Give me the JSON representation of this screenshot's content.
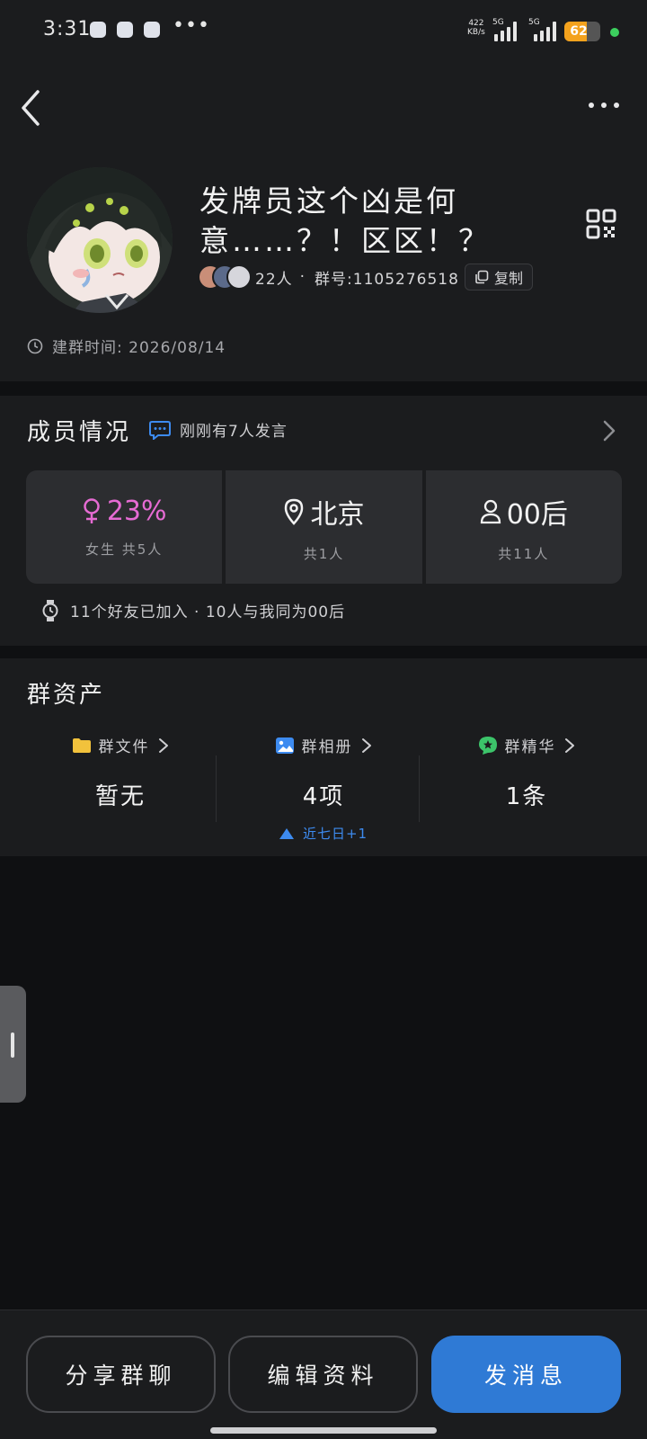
{
  "status_bar": {
    "time": "3:31",
    "more": "•••",
    "net_speed_value": "422",
    "net_speed_unit": "KB/s",
    "net_label_1": "5G",
    "net_label_2": "5G",
    "battery": "62",
    "battery_level": 0.62,
    "battery_color": "#f4a21d"
  },
  "header": {
    "group_name": "发牌员这个凶是何意……？！区区！？",
    "member_count": "22人",
    "separator": "·",
    "group_id": "群号:1105276518",
    "copy_label": "复制",
    "created": "建群时间: 2026/08/14"
  },
  "members": {
    "title": "成员情况",
    "activity": "刚刚有7人发言",
    "stats": [
      {
        "value": "23%",
        "sub": "女生 共5人",
        "icon": "female-icon",
        "color": "#e66bd3"
      },
      {
        "value": "北京",
        "sub": "共1人",
        "icon": "location-icon"
      },
      {
        "value": "00后",
        "sub": "共11人",
        "icon": "person-icon"
      }
    ],
    "friends_line": "11个好友已加入 · 10人与我同为00后"
  },
  "assets": {
    "title": "群资产",
    "items": [
      {
        "label": "群文件",
        "value": "暂无",
        "icon": "folder-icon",
        "color": "#f2c23c"
      },
      {
        "label": "群相册",
        "value": "4项",
        "icon": "image-icon",
        "color": "#3d8bf0",
        "trend": "近七日+1"
      },
      {
        "label": "群精华",
        "value": "1条",
        "icon": "star-badge-icon",
        "color": "#3cc46a"
      }
    ]
  },
  "bottom": {
    "share": "分享群聊",
    "edit": "编辑资料",
    "send": "发消息"
  },
  "colors": {
    "accent": "#2f7ad5",
    "background": "#0f1012",
    "card": "#1b1c1e"
  }
}
